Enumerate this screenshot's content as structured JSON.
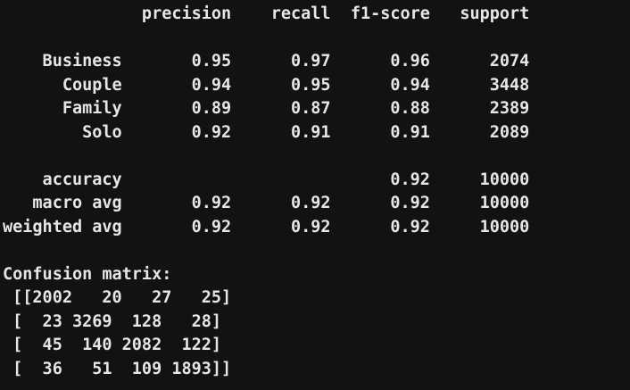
{
  "terminal": {
    "background_color": "#121212",
    "text_color": "#e6e6e6",
    "report_lines": [
      "              precision    recall  f1-score   support",
      "",
      "    Business       0.95      0.97      0.96      2074",
      "      Couple       0.94      0.95      0.94      3448",
      "      Family       0.89      0.87      0.88      2389",
      "        Solo       0.92      0.91      0.91      2089",
      "",
      "    accuracy                           0.92     10000",
      "   macro avg       0.92      0.92      0.92     10000",
      "weighted avg       0.92      0.92      0.92     10000",
      "",
      "Confusion matrix:",
      " [[2002   20   27   25]",
      " [  23 3269  128   28]",
      " [  45  140 2082  122]",
      " [  36   51  109 1893]]"
    ]
  }
}
